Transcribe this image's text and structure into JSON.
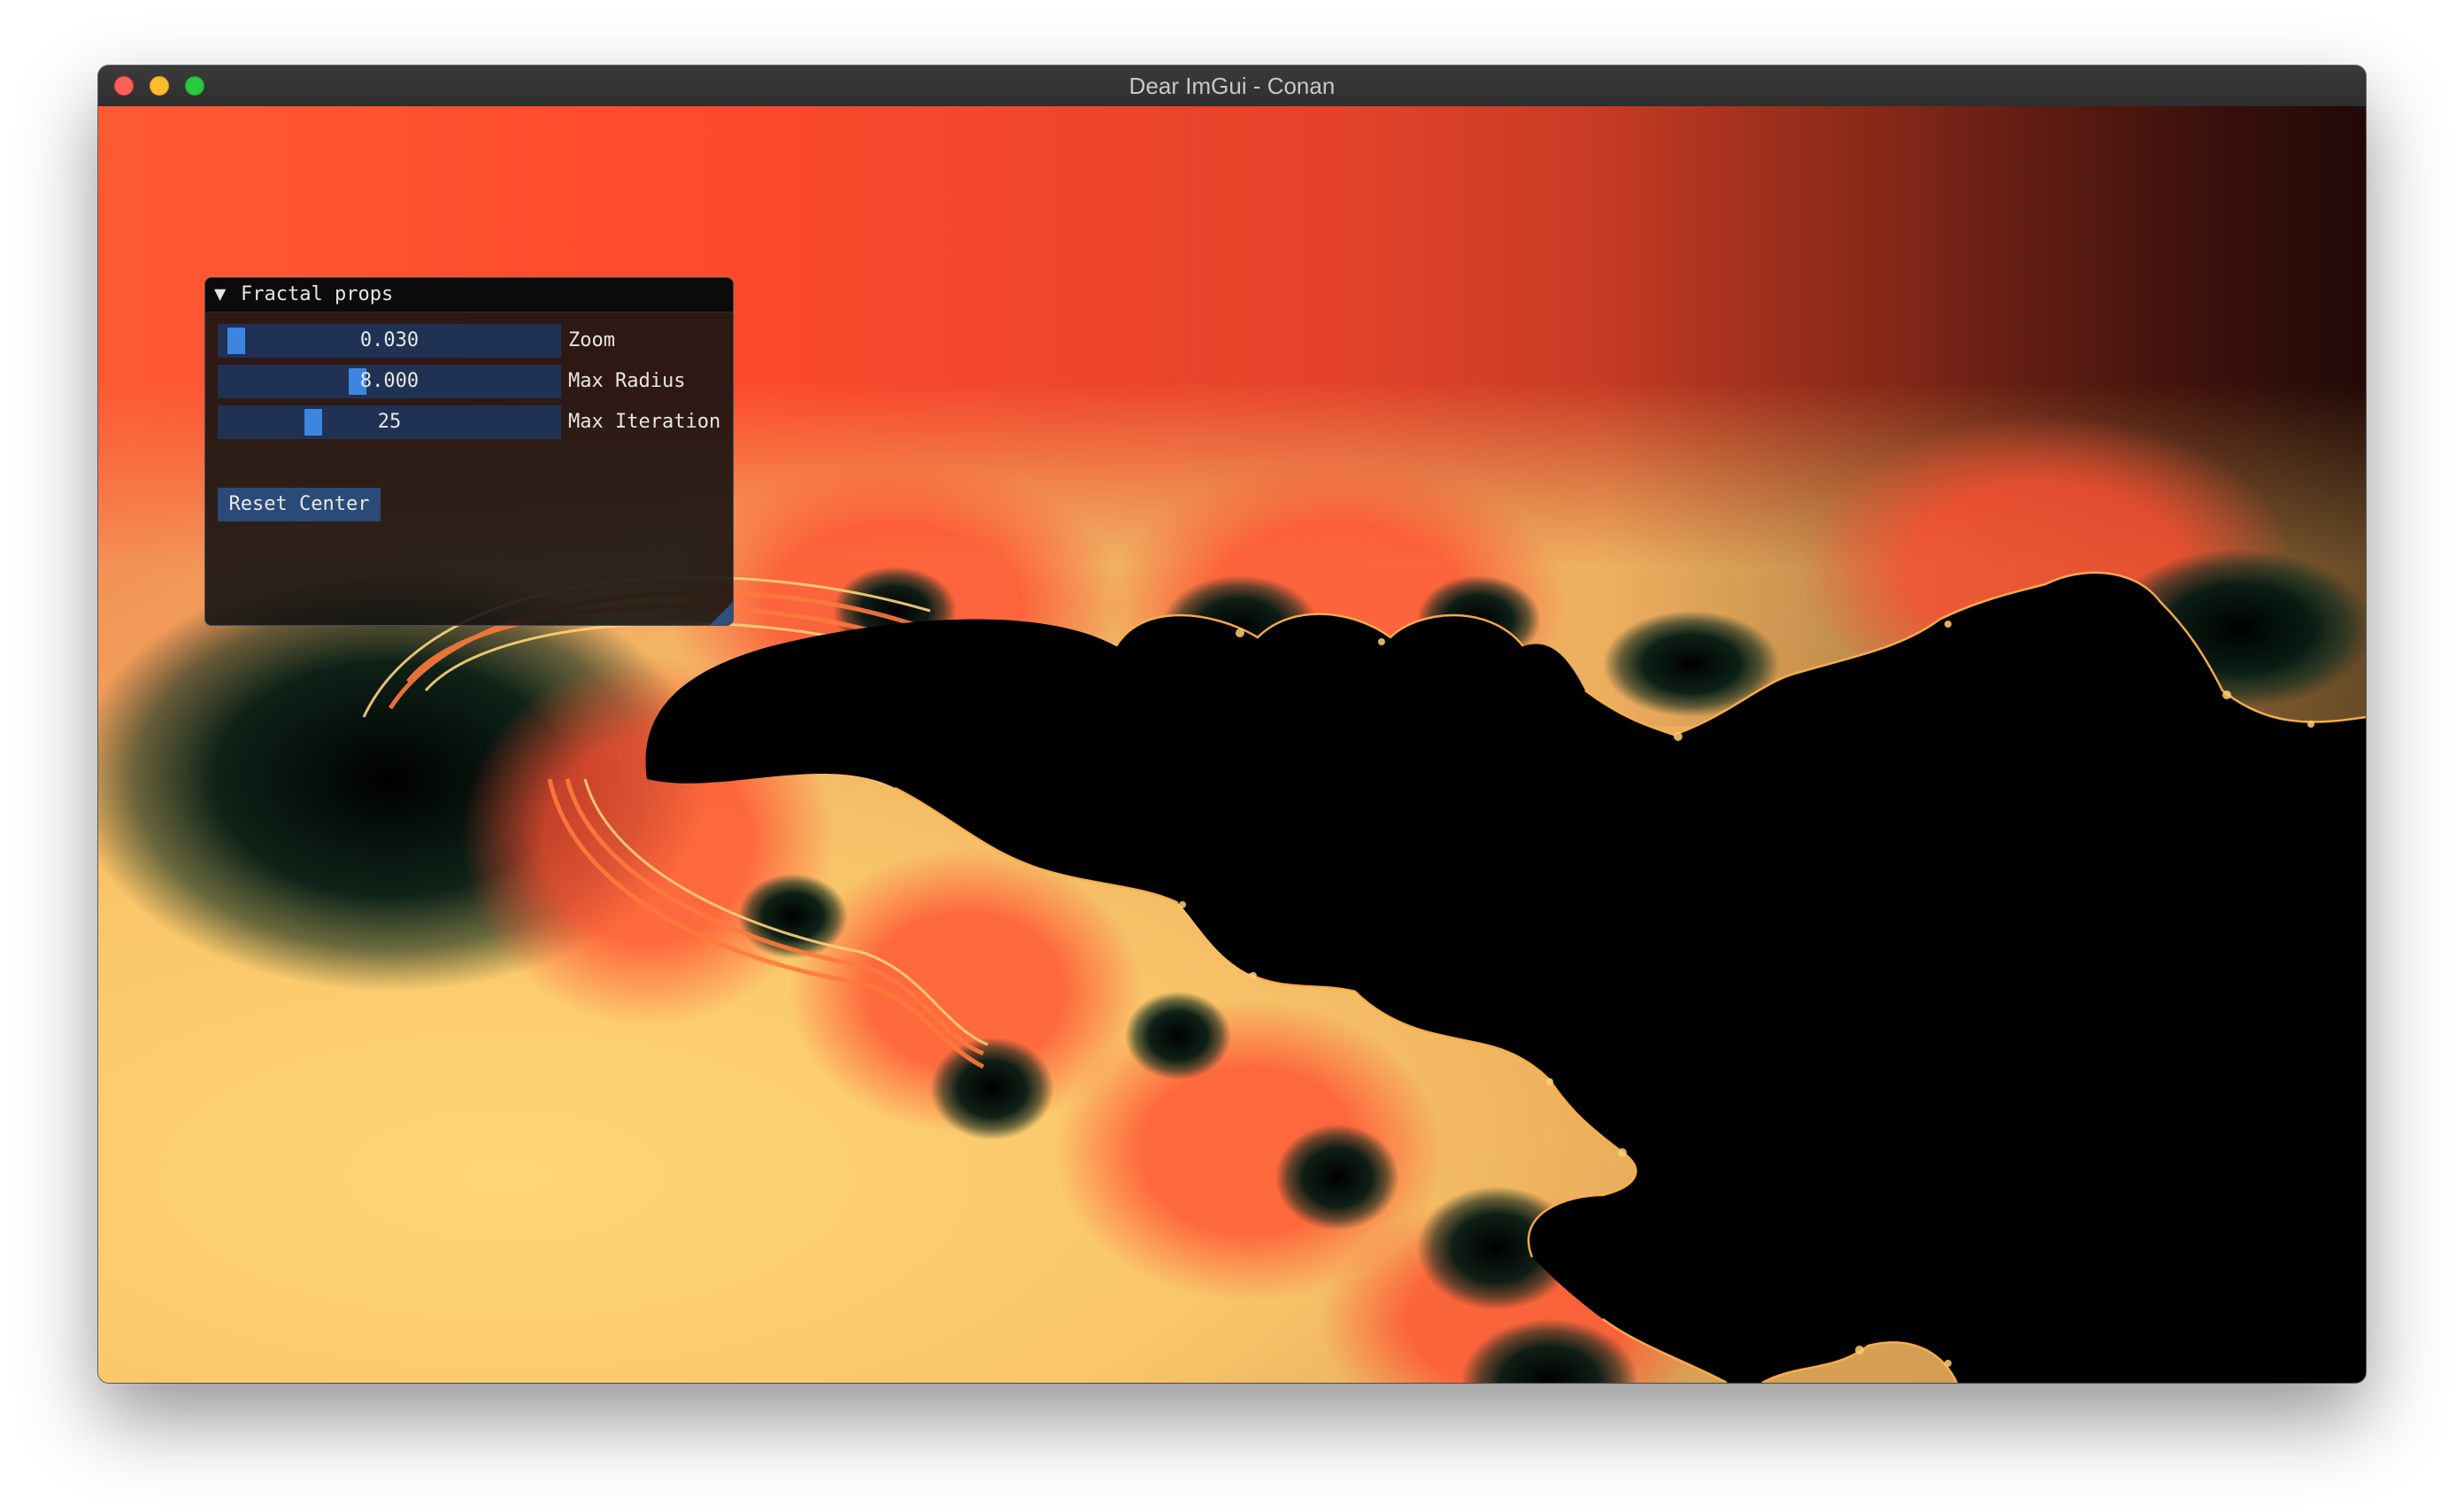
{
  "window": {
    "title": "Dear ImGui - Conan"
  },
  "panel": {
    "title": "Fractal props",
    "collapse_icon": "triangle-down-icon",
    "sliders": [
      {
        "label": "Zoom",
        "value": "0.030",
        "fraction": 0.02
      },
      {
        "label": "Max Radius",
        "value": "8.000",
        "fraction": 0.4
      },
      {
        "label": "Max Iteration",
        "value": "25",
        "fraction": 0.26
      }
    ],
    "reset_label": "Reset Center"
  },
  "colors": {
    "fractal_red": "#fe4a2f",
    "fractal_gold": "#fcd070",
    "fractal_dark": "#001a14",
    "slider_bg": "#1f3253",
    "slider_grab": "#3d85e0",
    "button_bg": "#2a4a78"
  }
}
